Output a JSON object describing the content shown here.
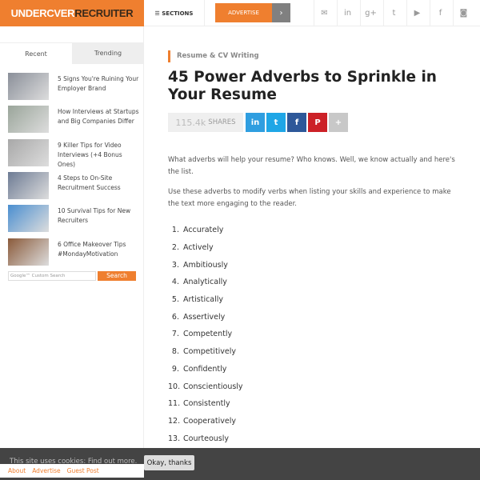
{
  "header": {
    "logo_a": "UNDERC",
    "logo_b": "VER",
    "logo_c": "RECRUITER",
    "sections": "☰ SECTIONS",
    "advertise": "ADVERTISE",
    "arrow": "›",
    "social": [
      {
        "icon": "email-icon",
        "glyph": "✉"
      },
      {
        "icon": "linkedin-icon",
        "glyph": "in"
      },
      {
        "icon": "googleplus-icon",
        "glyph": "g+"
      },
      {
        "icon": "twitter-icon",
        "glyph": "t"
      },
      {
        "icon": "youtube-icon",
        "glyph": "▶"
      },
      {
        "icon": "facebook-icon",
        "glyph": "f"
      },
      {
        "icon": "instagram-icon",
        "glyph": "◙"
      }
    ]
  },
  "sidebar": {
    "tabs": [
      "Recent",
      "Trending"
    ],
    "items": [
      {
        "title": "5 Signs You're Ruining Your Employer Brand",
        "color": "#8a8f99"
      },
      {
        "title": "How Interviews at Startups and Big Companies Differ",
        "color": "#9aa59a"
      },
      {
        "title": "9 Killer Tips for Video Interviews (+4 Bonus Ones)",
        "color": "#a8a8a8"
      },
      {
        "title": "4 Steps to On-Site Recruitment Success",
        "color": "#6d7b94"
      },
      {
        "title": "10 Survival Tips for New Recruiters",
        "color": "#4a8ed0"
      },
      {
        "title": "6 Office Makeover Tips #MondayMotivation",
        "color": "#8a5a3a"
      }
    ],
    "search_placeholder": "Google™ Custom Search",
    "search_button": "Search"
  },
  "article": {
    "category": "Resume & CV Writing",
    "title": "45 Power Adverbs to Sprinkle in Your Resume",
    "share_count": "115.4k",
    "share_label": "SHARES",
    "share_buttons": [
      {
        "icon": "linkedin-icon",
        "glyph": "in",
        "color": "#2f9ee0"
      },
      {
        "icon": "twitter-icon",
        "glyph": "t",
        "color": "#1fa6e6"
      },
      {
        "icon": "facebook-icon",
        "glyph": "f",
        "color": "#2e5899"
      },
      {
        "icon": "pinterest-icon",
        "glyph": "P",
        "color": "#cc2127"
      },
      {
        "icon": "more-icon",
        "glyph": "+",
        "color": "#c8c8c8"
      }
    ],
    "p1": "What adverbs will help your resume? Who knows. Well, we know actually and here's the list.",
    "p2": "Use these adverbs to modify verbs when listing your skills and experience to make the text more engaging to the reader.",
    "list": [
      "Accurately",
      "Actively",
      "Ambitiously",
      "Analytically",
      "Artistically",
      "Assertively",
      "Competently",
      "Competitively",
      "Confidently",
      "Conscientiously",
      "Consistently",
      "Cooperatively",
      "Courteously"
    ]
  },
  "cookie": {
    "text": "This site uses cookies: Find out more.",
    "button": "Okay, thanks"
  },
  "footer": {
    "links": [
      "About",
      "Advertise",
      "Guest Post"
    ]
  },
  "colors": {
    "accent": "#ef7f2f"
  }
}
